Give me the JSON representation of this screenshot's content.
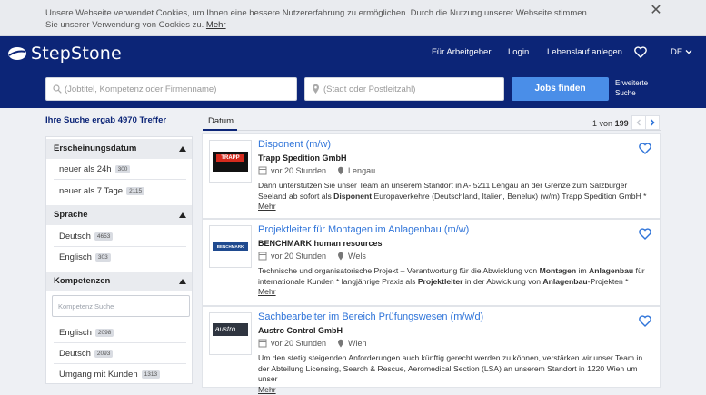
{
  "cookie": {
    "text": "Unsere Webseite verwendet Cookies, um Ihnen eine bessere Nutzererfahrung zu ermöglichen. Durch die Nutzung unserer Webseite stimmen Sie unserer Verwendung von Cookies zu.",
    "link": "Mehr",
    "close_icon": "close-icon"
  },
  "header": {
    "brand": "StepStone",
    "nav": [
      "Für Arbeitgeber",
      "Login",
      "Lebenslauf anlegen"
    ],
    "language": "DE",
    "search_placeholder": "(Jobtitel, Kompetenz oder Firmenname)",
    "location_placeholder": "(Stadt oder Postleitzahl)",
    "find_button": "Jobs finden",
    "advanced_search": "Erweiterte Suche",
    "colors": {
      "header_bg": "#0c2577",
      "button": "#4a8ee8",
      "link": "#2f74d9"
    }
  },
  "results": {
    "summary": "Ihre Suche ergab 4970 Treffer",
    "sort_tab": "Datum",
    "page_current": "1",
    "page_of": "von",
    "page_total": "199"
  },
  "filters": {
    "groups": [
      {
        "title": "Erscheinungsdatum",
        "options": [
          {
            "label": "neuer als 24h",
            "count": "300"
          },
          {
            "label": "neuer als 7 Tage",
            "count": "2115"
          }
        ]
      },
      {
        "title": "Sprache",
        "options": [
          {
            "label": "Deutsch",
            "count": "4653"
          },
          {
            "label": "Englisch",
            "count": "303"
          }
        ]
      },
      {
        "title": "Kompetenzen",
        "search_placeholder": "Kompetenz Suche",
        "options": [
          {
            "label": "Englisch",
            "count": "2098"
          },
          {
            "label": "Deutsch",
            "count": "2093"
          },
          {
            "label": "Umgang mit Kunden",
            "count": "1313"
          }
        ]
      }
    ]
  },
  "jobs": [
    {
      "title": "Disponent (m/w)",
      "company": "Trapp Spedition GmbH",
      "logo_text": "TRAPP",
      "posted": "vor 20 Stunden",
      "location": "Lengau",
      "desc_parts": [
        {
          "t": "Dann unterstützen Sie unser Team an unserem Standort in A- 5211 Lengau an der Grenze zum Salzburger Seeland ab sofort als "
        },
        {
          "b": "Disponent"
        },
        {
          "t": " Europaverkehre (Deutschland, Italien, Benelux) (w/m) Trapp Spedition GmbH *"
        }
      ],
      "more": "Mehr"
    },
    {
      "title": "Projektleiter für Montagen im Anlagenbau (m/w)",
      "company": "BENCHMARK human resources",
      "logo_text": "BENCHMARK",
      "posted": "vor 20 Stunden",
      "location": "Wels",
      "desc_parts": [
        {
          "t": "Technische und organisatorische Projekt – Verantwortung für die Abwicklung von "
        },
        {
          "b": "Montagen"
        },
        {
          "t": " im "
        },
        {
          "b": "Anlagenbau"
        },
        {
          "t": " für internationale Kunden * langjährige Praxis als "
        },
        {
          "b": "Projektleiter"
        },
        {
          "t": " in der Abwicklung von "
        },
        {
          "b": "Anlagenbau"
        },
        {
          "t": "-Projekten *"
        }
      ],
      "more": "Mehr"
    },
    {
      "title": "Sachbearbeiter im Bereich Prüfungswesen (m/w/d)",
      "company": "Austro Control GmbH",
      "logo_text": "austro",
      "posted": "vor 20 Stunden",
      "location": "Wien",
      "desc_parts": [
        {
          "t": "Um den stetig steigenden Anforderungen auch künftig gerecht werden zu können, verstärken wir unser Team in der Abteilung Licensing, Search & Rescue, Aeromedical Section (LSA) an unserem Standort in 1220 Wien um unser"
        }
      ],
      "more": "Mehr"
    }
  ]
}
